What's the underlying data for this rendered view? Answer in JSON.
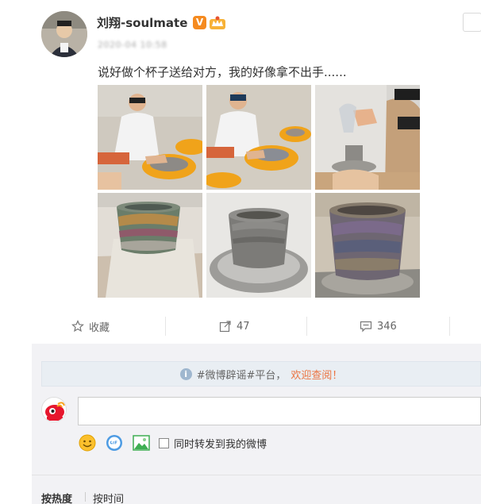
{
  "post": {
    "username": "刘翔-soulmate",
    "v_badge": "V",
    "time": "2020-04 10:58",
    "text": "说好做个杯子送给对方，我的好像拿不出手......"
  },
  "actions": {
    "favorite_label": "收藏",
    "repost_count": "47",
    "comment_count": "346"
  },
  "notice": {
    "icon_glyph": "i",
    "prefix": "#微博辟谣#平台，",
    "highlight": "欢迎查阅！"
  },
  "composer": {
    "placeholder": "",
    "repost_label": "同时转发到我的微博"
  },
  "sort": {
    "hot": "按热度",
    "time": "按时间"
  },
  "colors": {
    "accent_orange": "#eb7340",
    "v_badge": "#f58a1f",
    "comment_bg": "#f2f2f5",
    "notice_bg": "#e9eef3"
  },
  "icons": {
    "favorite": "star-icon",
    "repost": "repost-arrow-icon",
    "comment": "comment-bubble-icon",
    "emoji": "smiley-icon",
    "gif": "gif-icon",
    "image": "image-icon"
  }
}
